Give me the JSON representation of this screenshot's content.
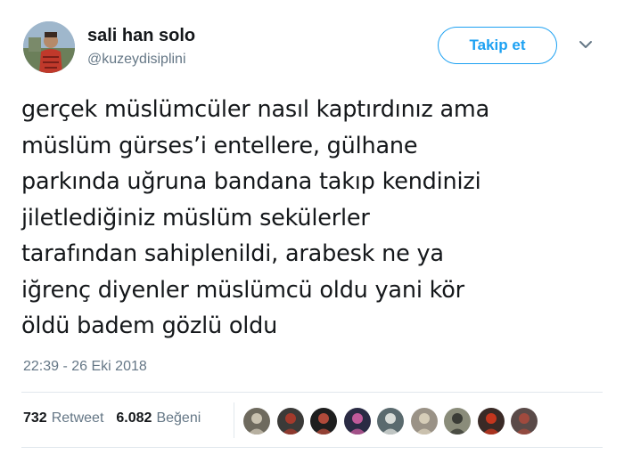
{
  "user": {
    "display_name": "sali han solo",
    "handle": "@kuzeydisiplini",
    "avatar_icon": "profile-photo-icon"
  },
  "follow_label": "Takip et",
  "tweet": {
    "lines": [
      "gerçek müslümcüler nasıl kaptırdınız ama",
      "müslüm gürses’i entellere, gülhane",
      "parkında uğruna bandana takıp kendinizi",
      "jiletlediğiniz müslüm sekülerler",
      "tarafından sahiplenildi, arabesk ne ya",
      "iğrenç diyenler müslümcü oldu yani kör",
      "öldü badem gözlü oldu"
    ],
    "timestamp": "22:39 - 26 Eki 2018"
  },
  "stats": {
    "retweets_count": "732",
    "retweets_label": "Retweet",
    "likes_count": "6.082",
    "likes_label": "Beğeni"
  },
  "likers": [
    {
      "name": "liker-avatar-1",
      "bg": "#6e6a5e",
      "fg": "#c9c2b0"
    },
    {
      "name": "liker-avatar-2",
      "bg": "#3b3a38",
      "fg": "#a33a2c"
    },
    {
      "name": "liker-avatar-3",
      "bg": "#1e1e1e",
      "fg": "#b04a3a"
    },
    {
      "name": "liker-avatar-4",
      "bg": "#2a2b44",
      "fg": "#c05a9a"
    },
    {
      "name": "liker-avatar-5",
      "bg": "#5a6a6e",
      "fg": "#d8dcd8"
    },
    {
      "name": "liker-avatar-6",
      "bg": "#9a9286",
      "fg": "#d6cdb8"
    },
    {
      "name": "liker-avatar-7",
      "bg": "#8a8c7a",
      "fg": "#3a3c36"
    },
    {
      "name": "liker-avatar-8",
      "bg": "#3a2a26",
      "fg": "#c4361e"
    },
    {
      "name": "liker-avatar-9",
      "bg": "#5a4a48",
      "fg": "#a04a3e"
    }
  ],
  "colors": {
    "accent": "#1da1f2",
    "text": "#14171a",
    "secondary": "#657786",
    "divider": "#e1e8ed"
  }
}
